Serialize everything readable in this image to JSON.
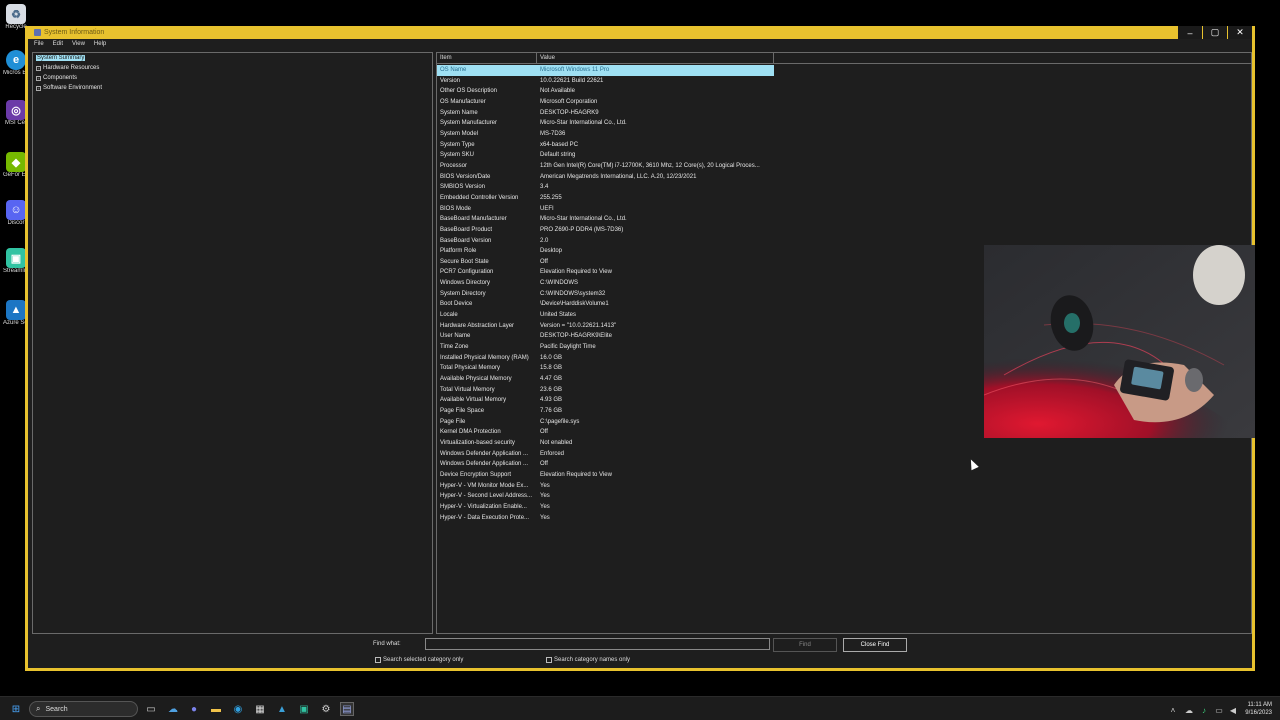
{
  "desktop": {
    "icons": [
      {
        "label": "Recycle",
        "icon": "recycle-bin-icon"
      },
      {
        "label": "Micros Edge",
        "icon": "edge-icon"
      },
      {
        "label": "MSI Cer",
        "icon": "msi-center-icon"
      },
      {
        "label": "GeFor Experie",
        "icon": "geforce-icon"
      },
      {
        "label": "Discor",
        "icon": "discord-icon"
      },
      {
        "label": "Streamli Deskto",
        "icon": "streamlabs-icon"
      },
      {
        "label": "Azure Softwa",
        "icon": "azure-icon"
      }
    ]
  },
  "window": {
    "title": "System Information",
    "menu": [
      "File",
      "Edit",
      "View",
      "Help"
    ],
    "controls": {
      "minimize": "–",
      "maximize": "▢",
      "close": "✕"
    }
  },
  "tree": {
    "items": [
      {
        "label": "System Summary",
        "selected": true,
        "expandable": false
      },
      {
        "label": "Hardware Resources",
        "selected": false,
        "expandable": true
      },
      {
        "label": "Components",
        "selected": false,
        "expandable": true
      },
      {
        "label": "Software Environment",
        "selected": false,
        "expandable": true
      }
    ]
  },
  "detail": {
    "columns": {
      "item": "Item",
      "value": "Value"
    },
    "rows": [
      {
        "item": "OS Name",
        "value": "Microsoft Windows 11 Pro",
        "selected": true
      },
      {
        "item": "Version",
        "value": "10.0.22621 Build 22621"
      },
      {
        "item": "Other OS Description",
        "value": "Not Available"
      },
      {
        "item": "OS Manufacturer",
        "value": "Microsoft Corporation"
      },
      {
        "item": "System Name",
        "value": "DESKTOP-H5AGRK9"
      },
      {
        "item": "System Manufacturer",
        "value": "Micro-Star International Co., Ltd."
      },
      {
        "item": "System Model",
        "value": "MS-7D36"
      },
      {
        "item": "System Type",
        "value": "x64-based PC"
      },
      {
        "item": "System SKU",
        "value": "Default string"
      },
      {
        "item": "Processor",
        "value": "12th Gen Intel(R) Core(TM) i7-12700K, 3610 Mhz, 12 Core(s), 20 Logical Proces..."
      },
      {
        "item": "BIOS Version/Date",
        "value": "American Megatrends International, LLC. A.20, 12/23/2021"
      },
      {
        "item": "SMBIOS Version",
        "value": "3.4"
      },
      {
        "item": "Embedded Controller Version",
        "value": "255.255"
      },
      {
        "item": "BIOS Mode",
        "value": "UEFI"
      },
      {
        "item": "BaseBoard Manufacturer",
        "value": "Micro-Star International Co., Ltd."
      },
      {
        "item": "BaseBoard Product",
        "value": "PRO Z690-P DDR4 (MS-7D36)"
      },
      {
        "item": "BaseBoard Version",
        "value": "2.0"
      },
      {
        "item": "Platform Role",
        "value": "Desktop"
      },
      {
        "item": "Secure Boot State",
        "value": "Off"
      },
      {
        "item": "PCR7 Configuration",
        "value": "Elevation Required to View"
      },
      {
        "item": "Windows Directory",
        "value": "C:\\WINDOWS"
      },
      {
        "item": "System Directory",
        "value": "C:\\WINDOWS\\system32"
      },
      {
        "item": "Boot Device",
        "value": "\\Device\\HarddiskVolume1"
      },
      {
        "item": "Locale",
        "value": "United States"
      },
      {
        "item": "Hardware Abstraction Layer",
        "value": "Version = \"10.0.22621.1413\""
      },
      {
        "item": "User Name",
        "value": "DESKTOP-H5AGRK9\\Elite"
      },
      {
        "item": "Time Zone",
        "value": "Pacific Daylight Time"
      },
      {
        "item": "Installed Physical Memory (RAM)",
        "value": "16.0 GB"
      },
      {
        "item": "Total Physical Memory",
        "value": "15.8 GB"
      },
      {
        "item": "Available Physical Memory",
        "value": "4.47 GB"
      },
      {
        "item": "Total Virtual Memory",
        "value": "23.6 GB"
      },
      {
        "item": "Available Virtual Memory",
        "value": "4.93 GB"
      },
      {
        "item": "Page File Space",
        "value": "7.76 GB"
      },
      {
        "item": "Page File",
        "value": "C:\\pagefile.sys"
      },
      {
        "item": "Kernel DMA Protection",
        "value": "Off"
      },
      {
        "item": "Virtualization-based security",
        "value": "Not enabled"
      },
      {
        "item": "Windows Defender Application ...",
        "value": "Enforced"
      },
      {
        "item": "Windows Defender Application ...",
        "value": "Off"
      },
      {
        "item": "Device Encryption Support",
        "value": "Elevation Required to View"
      },
      {
        "item": "Hyper-V - VM Monitor Mode Ex...",
        "value": "Yes"
      },
      {
        "item": "Hyper-V - Second Level Address...",
        "value": "Yes"
      },
      {
        "item": "Hyper-V - Virtualization Enable...",
        "value": "Yes"
      },
      {
        "item": "Hyper-V - Data Execution Prote...",
        "value": "Yes"
      }
    ]
  },
  "find": {
    "label": "Find what:",
    "value": "",
    "find_button": "Find",
    "close_button": "Close Find",
    "check_selected": "Search selected category only",
    "check_names": "Search category names only"
  },
  "taskbar": {
    "search_label": "Search",
    "time": "11:11 AM",
    "date": "9/16/2023"
  },
  "colors": {
    "window_border": "#e8c22e",
    "selection": "#9fe0f3"
  }
}
